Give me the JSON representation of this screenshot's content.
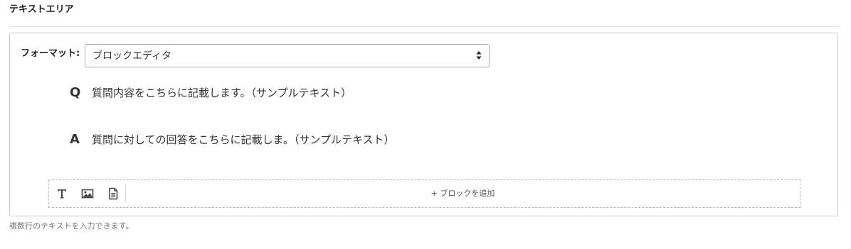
{
  "section": {
    "title": "テキストエリア",
    "help_text": "複数行のテキストを入力できます。"
  },
  "format": {
    "label": "フォーマット:",
    "selected": "ブロックエディタ"
  },
  "qa": {
    "question_letter": "Q",
    "question_text": "質問内容をこちらに記載します。（サンプルテキスト）",
    "answer_letter": "A",
    "answer_text": "質問に対しての回答をこちらに記載しま。（サンプルテキスト）"
  },
  "toolbar": {
    "icons": [
      "text-icon",
      "image-icon",
      "document-icon"
    ],
    "add_block_label": "+ ブロックを追加"
  }
}
